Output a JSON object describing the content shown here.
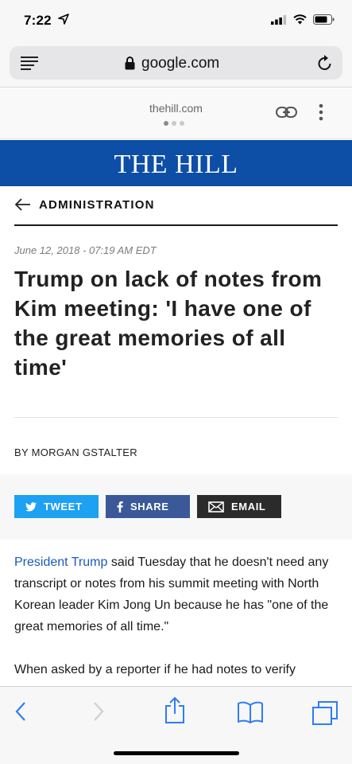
{
  "status_bar": {
    "time": "7:22"
  },
  "browser": {
    "url": "google.com",
    "amp_host": "thehill.com"
  },
  "site": {
    "logo": "THE HILL"
  },
  "article": {
    "section": "ADMINISTRATION",
    "date": "June 12, 2018 - 07:19 AM EDT",
    "headline": "Trump on lack of notes from Kim meeting: 'I have one of the great memories of all time'",
    "byline": "BY MORGAN GSTALTER",
    "paragraph1_link": "President Trump",
    "paragraph1_rest": " said Tuesday that he doesn't need any transcript or notes from his summit meeting with North Korean leader Kim Jong Un because he has \"one of the great memories of all time.\"",
    "paragraph2": "When asked by a reporter if he had notes to verify"
  },
  "share": {
    "tweet": "TWEET",
    "share": "SHARE",
    "email": "EMAIL"
  },
  "colors": {
    "masthead": "#0d4ea6",
    "twitter": "#1da1f2",
    "facebook": "#3b5998",
    "email": "#2b2b2b",
    "ios_blue": "#2f7cf6"
  },
  "icons": [
    "location-arrow-icon",
    "signal-icon",
    "wifi-icon",
    "battery-icon",
    "menu-icon",
    "lock-icon",
    "reload-icon",
    "link-icon",
    "more-vertical-icon",
    "back-arrow-icon",
    "twitter-icon",
    "facebook-icon",
    "email-icon",
    "back-icon",
    "forward-icon",
    "share-icon",
    "bookmarks-icon",
    "tabs-icon"
  ]
}
